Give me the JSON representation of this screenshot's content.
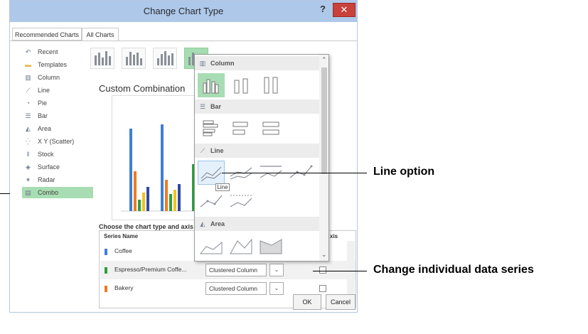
{
  "dialog": {
    "title": "Change Chart Type",
    "help_label": "?",
    "close_label": "✕",
    "tabs": [
      {
        "label": "Recommended Charts"
      },
      {
        "label": "All Charts"
      }
    ]
  },
  "sidebar": {
    "items": [
      {
        "label": "Recent",
        "icon": "↶"
      },
      {
        "label": "Templates",
        "icon": "▬"
      },
      {
        "label": "Column",
        "icon": "▥"
      },
      {
        "label": "Line",
        "icon": "⟋"
      },
      {
        "label": "Pie",
        "icon": "◔"
      },
      {
        "label": "Bar",
        "icon": "☰"
      },
      {
        "label": "Area",
        "icon": "◭"
      },
      {
        "label": "X Y (Scatter)",
        "icon": "⁛"
      },
      {
        "label": "Stock",
        "icon": "‖"
      },
      {
        "label": "Surface",
        "icon": "◈"
      },
      {
        "label": "Radar",
        "icon": "✶"
      },
      {
        "label": "Combo",
        "icon": "▤"
      }
    ],
    "selected": "Combo"
  },
  "main": {
    "section_title": "Custom Combination",
    "table_label": "Choose the chart type and axis for yo",
    "table_headers": {
      "series_name": "Series Name",
      "chart_type": "Ch",
      "axis": "xis"
    },
    "series": [
      {
        "name": "Coffee",
        "color": "#3f7fd4",
        "chart_type": ""
      },
      {
        "name": "Espresso/Premium Coffe...",
        "color": "#2e9e3e",
        "chart_type": "Clustered Column"
      },
      {
        "name": "Bakery",
        "color": "#ee7b22",
        "chart_type": "Clustered Column"
      }
    ],
    "dropdown_icon": "⌄",
    "ok_label": "OK",
    "cancel_label": "Cancel"
  },
  "popup": {
    "sections": [
      {
        "label": "Column",
        "icon": "▥"
      },
      {
        "label": "Bar",
        "icon": "☰"
      },
      {
        "label": "Line",
        "icon": "⟋"
      },
      {
        "label": "Area",
        "icon": "◭"
      }
    ],
    "tooltip": "Line",
    "scroll_up": "⌃",
    "scroll_down": "⌄"
  },
  "callouts": {
    "line_option": "Line option",
    "change_series": "Change individual data series"
  },
  "colors": {
    "accent_green": "#a8dcb2",
    "title_bar": "#aec8ea",
    "close_red": "#c9413b",
    "preview_series": [
      "#3f7fd4",
      "#ee7b22",
      "#2e9e3e",
      "#f2c21b",
      "#3048a8"
    ]
  }
}
